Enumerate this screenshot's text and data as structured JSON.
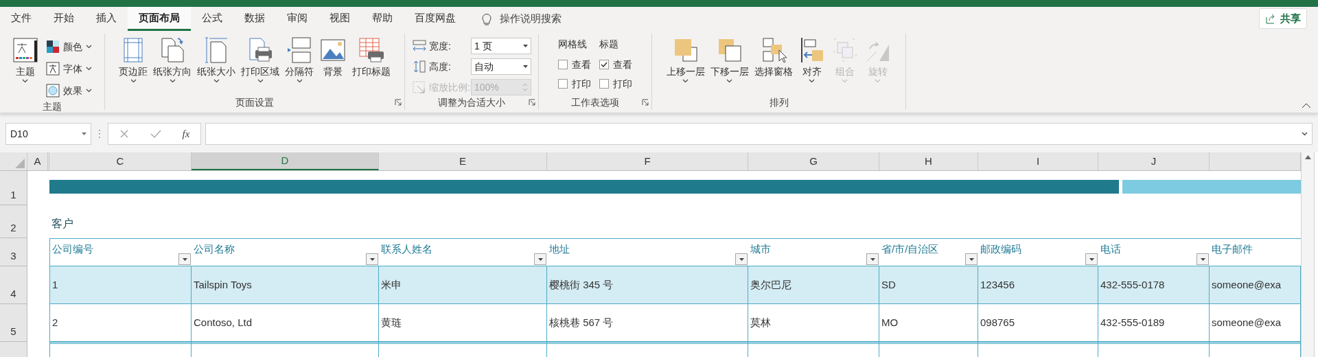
{
  "tabs": [
    {
      "label": "文件",
      "selected": false
    },
    {
      "label": "开始",
      "selected": false
    },
    {
      "label": "插入",
      "selected": false
    },
    {
      "label": "页面布局",
      "selected": true
    },
    {
      "label": "公式",
      "selected": false
    },
    {
      "label": "数据",
      "selected": false
    },
    {
      "label": "审阅",
      "selected": false
    },
    {
      "label": "视图",
      "selected": false
    },
    {
      "label": "帮助",
      "selected": false
    },
    {
      "label": "百度网盘",
      "selected": false
    }
  ],
  "tell_me": "操作说明搜索",
  "share_button": "共享",
  "ribbon_groups": [
    {
      "label": "主题",
      "items": [
        {
          "kind": "large",
          "label": "主题",
          "dropdown": true
        },
        {
          "kind": "stack",
          "items": [
            {
              "kind": "small",
              "label": "颜色",
              "dropdown": true
            },
            {
              "kind": "small",
              "label": "字体",
              "dropdown": true
            },
            {
              "kind": "small",
              "label": "效果",
              "dropdown": true
            }
          ]
        }
      ]
    },
    {
      "label": "页面设置",
      "launcher": true,
      "items": [
        {
          "kind": "large",
          "label": "页边距",
          "dropdown": true
        },
        {
          "kind": "large",
          "label": "纸张方向",
          "dropdown": true
        },
        {
          "kind": "large",
          "label": "纸张大小",
          "dropdown": true
        },
        {
          "kind": "large",
          "label": "打印区域",
          "dropdown": true
        },
        {
          "kind": "large",
          "label": "分隔符",
          "dropdown": true
        },
        {
          "kind": "large",
          "label": "背景",
          "dropdown": false
        },
        {
          "kind": "large",
          "label": "打印标题",
          "dropdown": false
        }
      ]
    },
    {
      "label": "调整为合适大小",
      "launcher": true,
      "items": [
        {
          "kind": "stack",
          "items": [
            {
              "kind": "select",
              "label": "宽度:",
              "value": "1 页",
              "disabled": false
            },
            {
              "kind": "select",
              "label": "高度:",
              "value": "自动",
              "disabled": false
            },
            {
              "kind": "spinner",
              "label": "缩放比例:",
              "value": "100%",
              "disabled": true
            }
          ]
        }
      ]
    },
    {
      "label": "工作表选项",
      "launcher": true,
      "items": [
        {
          "kind": "stack",
          "heading": "网格线",
          "items": [
            {
              "kind": "checkbox",
              "label": "查看",
              "checked": false
            },
            {
              "kind": "checkbox",
              "label": "打印",
              "checked": false
            }
          ]
        },
        {
          "kind": "stack",
          "heading": "标题",
          "items": [
            {
              "kind": "checkbox",
              "label": "查看",
              "checked": true
            },
            {
              "kind": "checkbox",
              "label": "打印",
              "checked": false
            }
          ]
        }
      ]
    },
    {
      "label": "排列",
      "items": [
        {
          "kind": "large",
          "label": "上移一层",
          "dropdown": true,
          "disabled": false
        },
        {
          "kind": "large",
          "label": "下移一层",
          "dropdown": true,
          "disabled": false
        },
        {
          "kind": "large",
          "label": "选择窗格",
          "dropdown": false,
          "disabled": false
        },
        {
          "kind": "large",
          "label": "对齐",
          "dropdown": true,
          "disabled": false
        },
        {
          "kind": "large",
          "label": "组合",
          "dropdown": true,
          "disabled": true
        },
        {
          "kind": "large",
          "label": "旋转",
          "dropdown": true,
          "disabled": true
        }
      ]
    }
  ],
  "name_box": "D10",
  "fx": "fx",
  "columns": [
    {
      "letter": "A",
      "selected": false
    },
    {
      "letter": "C",
      "selected": false
    },
    {
      "letter": "D",
      "selected": true
    },
    {
      "letter": "E",
      "selected": false
    },
    {
      "letter": "F",
      "selected": false
    },
    {
      "letter": "G",
      "selected": false
    },
    {
      "letter": "H",
      "selected": false
    },
    {
      "letter": "I",
      "selected": false
    },
    {
      "letter": "J",
      "selected": false
    }
  ],
  "row_numbers": [
    "1",
    "2",
    "3",
    "4",
    "5"
  ],
  "sheet_title": "客户",
  "table": {
    "columns": [
      "公司编号",
      "公司名称",
      "联系人姓名",
      "地址",
      "城市",
      "省/市/自治区",
      "邮政编码",
      "电话",
      "电子邮件"
    ],
    "rows": [
      [
        "1",
        "Tailspin Toys",
        "米申",
        "樱桃街 345 号",
        "奥尔巴尼",
        "SD",
        "123456",
        "432-555-0178",
        "someone@exa"
      ],
      [
        "2",
        "Contoso, Ltd",
        "黄琏",
        "核桃巷 567 号",
        "莫林",
        "MO",
        "098765",
        "432-555-0189",
        "someone@exa"
      ]
    ]
  }
}
